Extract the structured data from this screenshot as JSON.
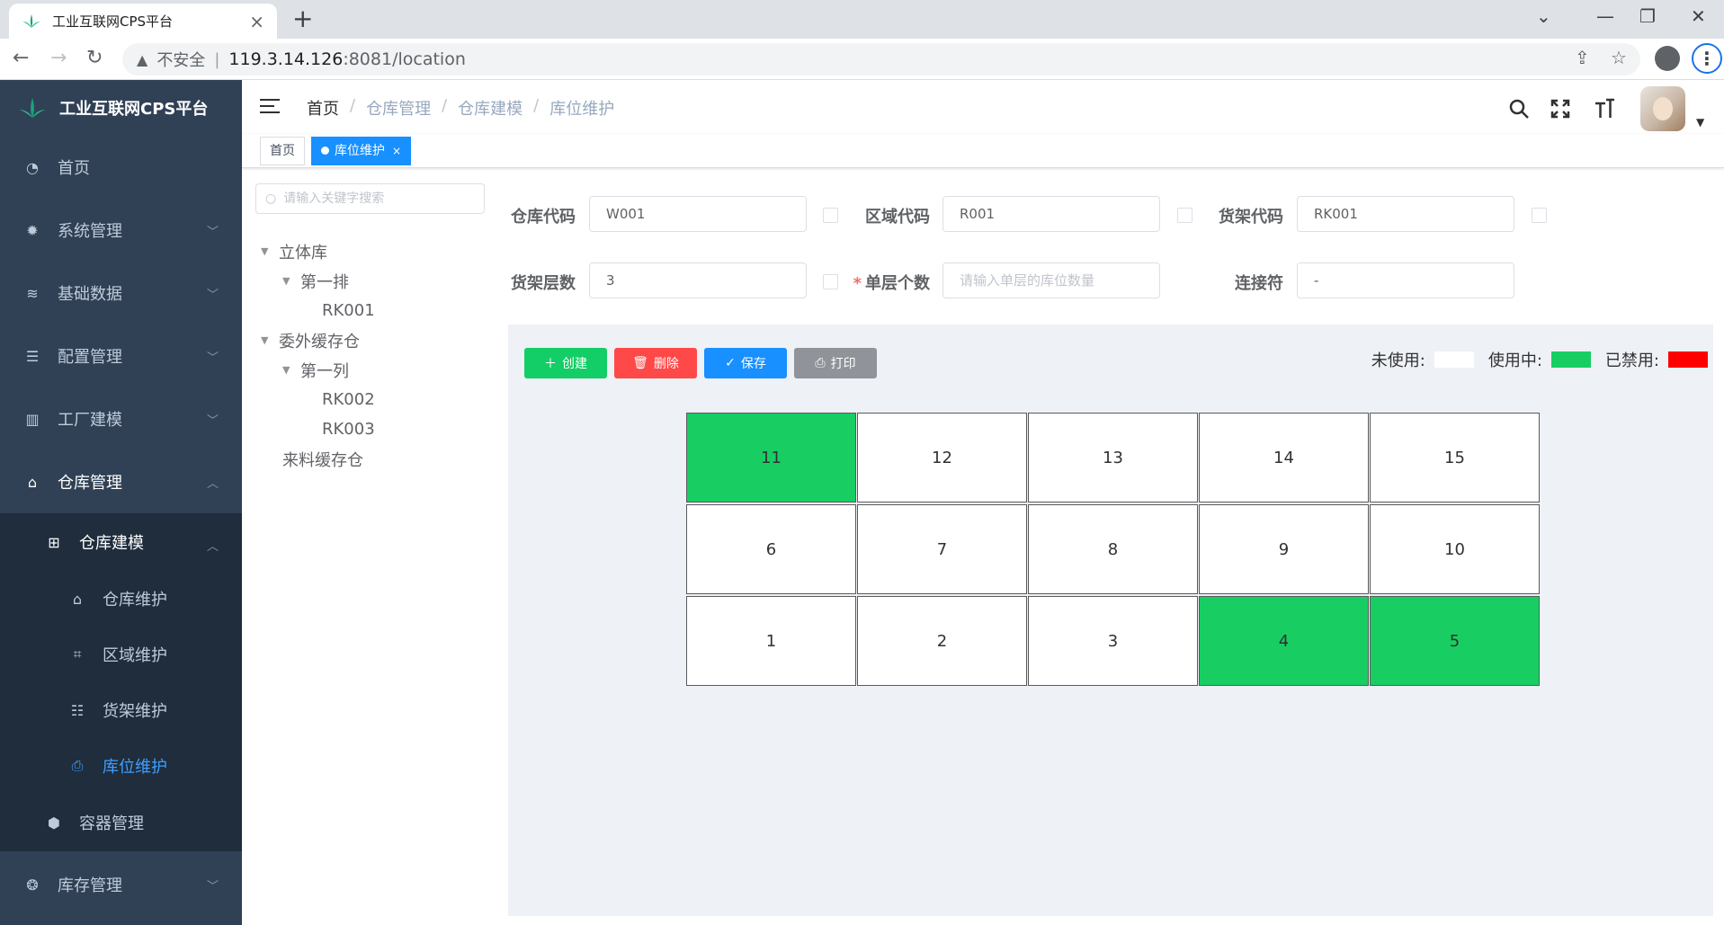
{
  "browser": {
    "tab_title": "工业互联网CPS平台",
    "tab_close": "×",
    "new_tab": "+",
    "not_secure": "不安全",
    "url_host": "119.3.14.126",
    "url_path": ":8081/location",
    "minimize": "—",
    "restore": "❐",
    "close": "✕",
    "tab_search": "⌄",
    "menu": "⋮"
  },
  "sidebar": {
    "logo_title": "工业互联网CPS平台",
    "items": [
      {
        "label": "首页",
        "icon": "dashboard-icon"
      },
      {
        "label": "系统管理",
        "icon": "gear-icon"
      },
      {
        "label": "基础数据",
        "icon": "layers-icon"
      },
      {
        "label": "配置管理",
        "icon": "sliders-icon"
      },
      {
        "label": "工厂建模",
        "icon": "building-icon"
      },
      {
        "label": "仓库管理",
        "icon": "warehouse-icon"
      }
    ],
    "sub_parent": {
      "label": "仓库建模",
      "icon": "grid-icon"
    },
    "sub_items": [
      {
        "label": "仓库维护",
        "icon": "warehouse-icon"
      },
      {
        "label": "区域维护",
        "icon": "frame-icon"
      },
      {
        "label": "货架维护",
        "icon": "shelf-icon"
      },
      {
        "label": "库位维护",
        "icon": "inbox-icon"
      }
    ],
    "container_item": {
      "label": "容器管理",
      "icon": "box-icon"
    },
    "stock_item": {
      "label": "库存管理",
      "icon": "coins-icon"
    }
  },
  "navbar": {
    "breadcrumbs": [
      "首页",
      "仓库管理",
      "仓库建模",
      "库位维护"
    ],
    "separator": "/"
  },
  "tags": {
    "home": "首页",
    "active": "库位维护",
    "close": "×"
  },
  "tree": {
    "search_placeholder": "请输入关键字搜索",
    "nodes": [
      {
        "label": "立体库"
      },
      {
        "label": "第一排"
      },
      {
        "label": "RK001"
      },
      {
        "label": "委外缓存仓"
      },
      {
        "label": "第一列"
      },
      {
        "label": "RK002"
      },
      {
        "label": "RK003"
      },
      {
        "label": "来料缓存仓"
      }
    ]
  },
  "form": {
    "warehouse_code_label": "仓库代码",
    "warehouse_code_value": "W001",
    "area_code_label": "区域代码",
    "area_code_value": "R001",
    "rack_code_label": "货架代码",
    "rack_code_value": "RK001",
    "rack_layers_label": "货架层数",
    "rack_layers_value": "3",
    "per_layer_label": "单层个数",
    "per_layer_required": "*",
    "per_layer_placeholder": "请输入单层的库位数量",
    "connector_label": "连接符",
    "connector_value": "-"
  },
  "toolbar": {
    "create": "创建",
    "delete": "删除",
    "save": "保存",
    "print": "打印"
  },
  "legend": {
    "unused": "未使用:",
    "in_use": "使用中:",
    "disabled": "已禁用:",
    "unused_color": "#ffffff",
    "in_use_color": "#18ce63",
    "disabled_color": "#ff0000"
  },
  "grid": {
    "rows": [
      [
        {
          "n": "11",
          "used": true
        },
        {
          "n": "12",
          "used": false
        },
        {
          "n": "13",
          "used": false
        },
        {
          "n": "14",
          "used": false
        },
        {
          "n": "15",
          "used": false
        }
      ],
      [
        {
          "n": "6",
          "used": false
        },
        {
          "n": "7",
          "used": false
        },
        {
          "n": "8",
          "used": false
        },
        {
          "n": "9",
          "used": false
        },
        {
          "n": "10",
          "used": false
        }
      ],
      [
        {
          "n": "1",
          "used": false
        },
        {
          "n": "2",
          "used": false
        },
        {
          "n": "3",
          "used": false
        },
        {
          "n": "4",
          "used": true
        },
        {
          "n": "5",
          "used": true
        }
      ]
    ]
  }
}
